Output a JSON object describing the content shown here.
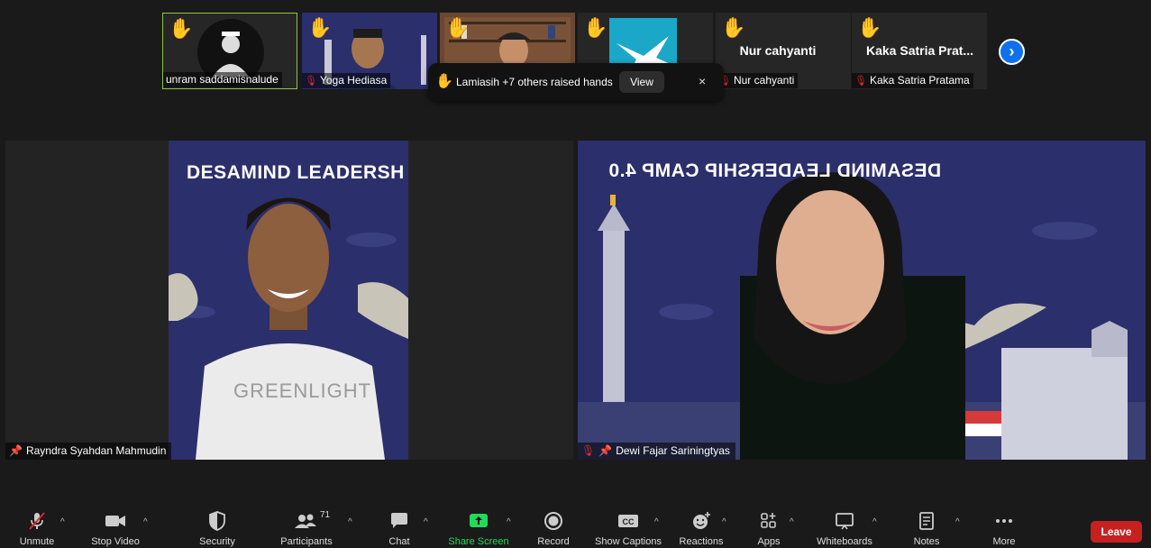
{
  "thumbnails": [
    {
      "name": "unram saddamisnalude",
      "muted": false,
      "hand": true
    },
    {
      "name": "Yoga Hediasa",
      "muted": true,
      "hand": true
    },
    {
      "name": "",
      "muted": false,
      "hand": true
    },
    {
      "name": "",
      "muted": false,
      "hand": true
    },
    {
      "name": "Nur cahyanti",
      "display": "Nur cahyanti",
      "muted": true,
      "hand": true
    },
    {
      "name": "Kaka Satria Pratama",
      "display": "Kaka Satria Prat...",
      "muted": true,
      "hand": true
    }
  ],
  "toast": {
    "text": "Lamiasih +7 others raised hands",
    "view_label": "View",
    "close": "×"
  },
  "videos": [
    {
      "banner": "DESAMIND LEADERSH",
      "shirt": "GREENLIGHT",
      "name": "Rayndra Syahdan Mahmudin"
    },
    {
      "banner": "DESAMIND LEADERSHIP CAMP 4.0",
      "name": "Dewi Fajar Sariningtyas"
    }
  ],
  "toolbar": {
    "unmute": "Unmute",
    "stop_video": "Stop Video",
    "security": "Security",
    "participants": "Participants",
    "participants_count": "71",
    "chat": "Chat",
    "share_screen": "Share Screen",
    "record": "Record",
    "show_captions": "Show Captions",
    "reactions": "Reactions",
    "apps": "Apps",
    "whiteboards": "Whiteboards",
    "notes": "Notes",
    "more": "More",
    "leave": "Leave"
  },
  "colors": {
    "accent": "#0e72ed",
    "share": "#23d959",
    "leave": "#c62020",
    "muted": "#e02828",
    "active_border": "#8dc63f",
    "banner_bg": "#2b2f6b"
  }
}
